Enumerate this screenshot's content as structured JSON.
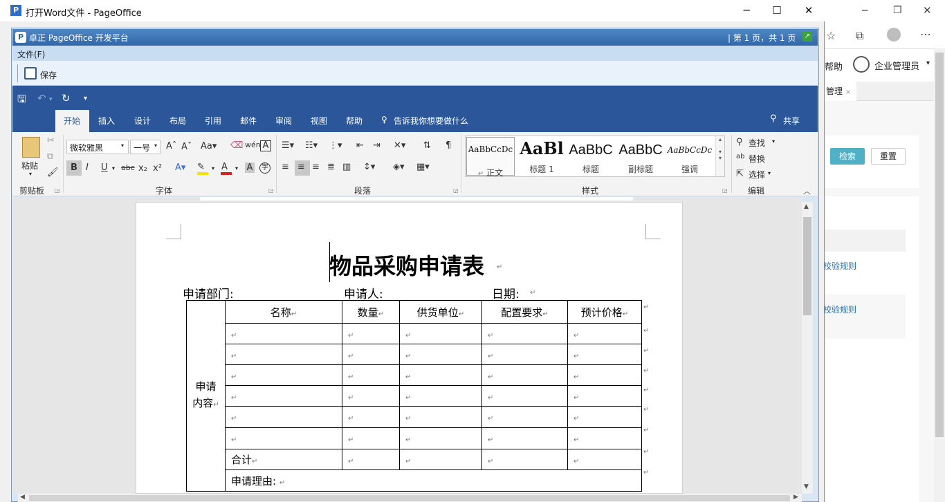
{
  "window": {
    "title": "打开Word文件 - PageOffice",
    "app_icon": "P",
    "min": "─",
    "max": "☐",
    "close": "✕"
  },
  "pageoffice": {
    "title": "卓正 PageOffice 开发平台",
    "page_info": "| 第 1 页，共 1 页",
    "file_menu": "文件(F)",
    "save_label": "保存"
  },
  "ribbon": {
    "tabs": [
      "开始",
      "插入",
      "设计",
      "布局",
      "引用",
      "邮件",
      "审阅",
      "视图",
      "帮助"
    ],
    "tell_me": "告诉我你想要做什么",
    "share": "共享",
    "paste": "粘贴",
    "font_name": "微软雅黑",
    "font_size": "一号",
    "groups": [
      "剪贴板",
      "字体",
      "段落",
      "样式",
      "编辑"
    ],
    "styles": [
      {
        "preview": "AaBbCcDc",
        "label": "正文"
      },
      {
        "preview": "AaBl",
        "label": "标题 1"
      },
      {
        "preview": "AaBbC",
        "label": "标题"
      },
      {
        "preview": "AaBbC",
        "label": "副标题"
      },
      {
        "preview": "AaBbCcDc",
        "label": "强调"
      }
    ],
    "find": "查找",
    "replace": "替换",
    "select": "选择"
  },
  "document": {
    "title": "物品采购申请表",
    "dept_label": "申请部门:",
    "applicant_label": "申请人:",
    "date_label": "日期:",
    "side_label_1": "申请",
    "side_label_2": "内容",
    "columns": [
      "名称",
      "数量",
      "供货单位",
      "配置要求",
      "预计价格"
    ],
    "total_label": "合计",
    "reason_label": "申请理由:",
    "para_mark": "↵"
  },
  "background_app": {
    "help": "帮助",
    "user": "企业管理员",
    "tab": "管理",
    "search_btn": "检索",
    "reset_btn": "重置",
    "link1": "校验规则",
    "link2": "校验规则"
  },
  "colors": {
    "word_blue": "#2b579a",
    "po_bar": "#2f67a9",
    "search_btn": "#4fb0c6"
  }
}
